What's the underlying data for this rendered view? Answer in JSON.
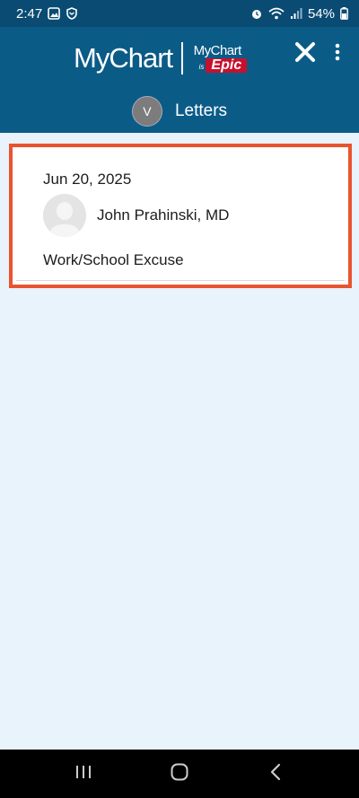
{
  "status_bar": {
    "time": "2:47",
    "battery": "54%",
    "left_icons": [
      "image-icon",
      "shield-icon"
    ],
    "right_icons": [
      "alarm-icon",
      "wifi-icon",
      "signal-icon",
      "battery-icon"
    ]
  },
  "header": {
    "brand_main": "MyChart",
    "brand_sub_top": "MyChart",
    "brand_is": "is",
    "brand_epic": "Epic",
    "close_icon": "close-icon",
    "more_icon": "more-vertical-icon",
    "bg_color": "#0b5b87"
  },
  "title_bar": {
    "avatar_initial": "V",
    "title": "Letters"
  },
  "letters": [
    {
      "date": "Jun 20, 2025",
      "provider": "John Prahinski, MD",
      "type": "Work/School Excuse",
      "highlight_color": "#e8542f"
    }
  ],
  "nav": {
    "recent_icon": "recent-apps-icon",
    "home_icon": "home-icon",
    "back_icon": "back-icon"
  }
}
